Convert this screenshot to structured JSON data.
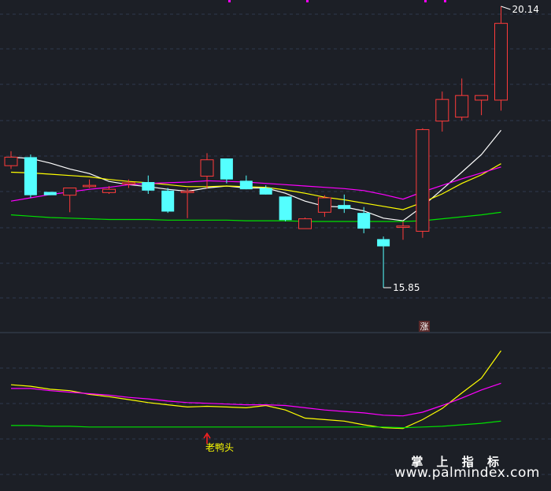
{
  "chart_data": {
    "type": "candlestick",
    "price_axis": {
      "min": 15.85,
      "max": 20.14
    },
    "high_label": "20.14",
    "low_label": "15.85",
    "candles": [
      {
        "o": 17.71,
        "c": 17.84,
        "h": 17.93,
        "l": 17.66
      },
      {
        "o": 17.84,
        "c": 17.26,
        "h": 17.88,
        "l": 17.22
      },
      {
        "o": 17.31,
        "c": 17.26,
        "h": 17.31,
        "l": 17.26
      },
      {
        "o": 17.26,
        "c": 17.37,
        "h": 17.37,
        "l": 17.0
      },
      {
        "o": 17.39,
        "c": 17.41,
        "h": 17.5,
        "l": 17.37
      },
      {
        "o": 17.3,
        "c": 17.35,
        "h": 17.4,
        "l": 17.28
      },
      {
        "o": 17.43,
        "c": 17.45,
        "h": 17.5,
        "l": 17.37
      },
      {
        "o": 17.46,
        "c": 17.33,
        "h": 17.56,
        "l": 17.28
      },
      {
        "o": 17.33,
        "c": 17.01,
        "h": 17.37,
        "l": 16.99
      },
      {
        "o": 17.3,
        "c": 17.32,
        "h": 17.36,
        "l": 16.91
      },
      {
        "o": 17.55,
        "c": 17.8,
        "h": 17.9,
        "l": 17.36
      },
      {
        "o": 17.82,
        "c": 17.5,
        "h": 17.82,
        "l": 17.44
      },
      {
        "o": 17.48,
        "c": 17.35,
        "h": 17.56,
        "l": 17.35
      },
      {
        "o": 17.37,
        "c": 17.27,
        "h": 17.41,
        "l": 17.27
      },
      {
        "o": 17.24,
        "c": 16.88,
        "h": 17.24,
        "l": 16.86
      },
      {
        "o": 16.75,
        "c": 16.9,
        "h": 16.92,
        "l": 16.75
      },
      {
        "o": 17.0,
        "c": 17.22,
        "h": 17.26,
        "l": 16.93
      },
      {
        "o": 17.11,
        "c": 17.05,
        "h": 17.27,
        "l": 16.99
      },
      {
        "o": 16.99,
        "c": 16.75,
        "h": 17.08,
        "l": 16.68
      },
      {
        "o": 16.59,
        "c": 16.48,
        "h": 16.63,
        "l": 15.85
      },
      {
        "o": 16.77,
        "c": 16.79,
        "h": 16.86,
        "l": 16.58
      },
      {
        "o": 16.71,
        "c": 18.26,
        "h": 18.28,
        "l": 16.61
      },
      {
        "o": 18.39,
        "c": 18.72,
        "h": 18.84,
        "l": 18.23
      },
      {
        "o": 18.45,
        "c": 18.78,
        "h": 19.04,
        "l": 18.4
      },
      {
        "o": 18.71,
        "c": 18.78,
        "h": 18.78,
        "l": 18.48
      },
      {
        "o": 18.71,
        "c": 19.88,
        "h": 20.14,
        "l": 18.55
      }
    ],
    "ma_lines": [
      {
        "color": "#ffffff",
        "values": [
          17.84,
          17.82,
          17.75,
          17.66,
          17.59,
          17.47,
          17.42,
          17.39,
          17.35,
          17.32,
          17.37,
          17.4,
          17.37,
          17.37,
          17.29,
          17.17,
          17.09,
          17.08,
          17.02,
          16.91,
          16.87,
          17.09,
          17.35,
          17.61,
          17.88,
          18.25
        ]
      },
      {
        "color": "#ffff00",
        "values": [
          17.61,
          17.6,
          17.58,
          17.56,
          17.54,
          17.5,
          17.47,
          17.45,
          17.42,
          17.39,
          17.39,
          17.4,
          17.39,
          17.38,
          17.34,
          17.29,
          17.23,
          17.19,
          17.14,
          17.09,
          17.04,
          17.15,
          17.28,
          17.44,
          17.57,
          17.74
        ]
      },
      {
        "color": "#ff00ff",
        "values": [
          17.17,
          17.22,
          17.27,
          17.31,
          17.35,
          17.38,
          17.42,
          17.44,
          17.45,
          17.46,
          17.48,
          17.47,
          17.46,
          17.44,
          17.42,
          17.4,
          17.38,
          17.36,
          17.33,
          17.27,
          17.2,
          17.31,
          17.41,
          17.51,
          17.6,
          17.69
        ]
      },
      {
        "color": "#00e000",
        "values": [
          16.96,
          16.94,
          16.92,
          16.91,
          16.9,
          16.89,
          16.89,
          16.89,
          16.88,
          16.88,
          16.88,
          16.88,
          16.87,
          16.87,
          16.87,
          16.86,
          16.86,
          16.86,
          16.86,
          16.86,
          16.86,
          16.87,
          16.9,
          16.93,
          16.96,
          17.0
        ]
      }
    ],
    "sub_indicator": {
      "annotation": "老鸭头",
      "annotation_index": 10,
      "lines": [
        {
          "color": "#ffff00",
          "values": [
            0.87,
            0.85,
            0.81,
            0.79,
            0.74,
            0.71,
            0.67,
            0.63,
            0.6,
            0.57,
            0.58,
            0.57,
            0.56,
            0.59,
            0.53,
            0.42,
            0.4,
            0.38,
            0.33,
            0.29,
            0.28,
            0.4,
            0.55,
            0.76,
            0.96,
            1.33
          ]
        },
        {
          "color": "#ff00ff",
          "values": [
            0.82,
            0.82,
            0.79,
            0.77,
            0.75,
            0.73,
            0.7,
            0.68,
            0.65,
            0.63,
            0.62,
            0.61,
            0.6,
            0.6,
            0.59,
            0.56,
            0.53,
            0.51,
            0.49,
            0.46,
            0.45,
            0.5,
            0.59,
            0.69,
            0.8,
            0.89
          ]
        },
        {
          "color": "#00e000",
          "values": [
            0.32,
            0.32,
            0.31,
            0.31,
            0.3,
            0.3,
            0.3,
            0.3,
            0.3,
            0.3,
            0.3,
            0.3,
            0.3,
            0.3,
            0.3,
            0.3,
            0.3,
            0.3,
            0.3,
            0.3,
            0.29,
            0.3,
            0.31,
            0.33,
            0.35,
            0.38
          ]
        }
      ]
    },
    "zhang_marker": "涨",
    "colors": {
      "up": "#ff3b3b",
      "down": "#54ffff",
      "grid": "#2e3a4e",
      "background": "#1c1f26"
    }
  },
  "watermark": {
    "title": "掌 上 指 标",
    "url": "www.palmindex.com"
  }
}
